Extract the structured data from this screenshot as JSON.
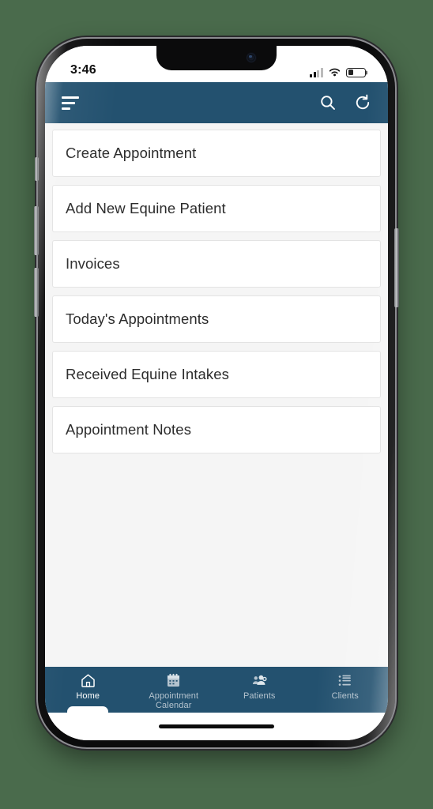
{
  "status_bar": {
    "time": "3:46",
    "signal_icon": "cellular-signal-icon",
    "signal_bars_filled": 2,
    "signal_bars_total": 4,
    "wifi_icon": "wifi-icon",
    "battery_icon": "battery-icon",
    "battery_percent": 32
  },
  "app_bar": {
    "menu_icon": "hamburger-menu-icon",
    "search_icon": "search-icon",
    "refresh_icon": "refresh-icon",
    "background_color": "#23516f"
  },
  "main": {
    "background_color": "#f5f5f5",
    "menu_items": [
      {
        "label": "Create Appointment"
      },
      {
        "label": "Add New Equine Patient"
      },
      {
        "label": "Invoices"
      },
      {
        "label": "Today's Appointments"
      },
      {
        "label": "Received Equine Intakes"
      },
      {
        "label": "Appointment Notes"
      }
    ]
  },
  "bottom_nav": {
    "background_color": "#23516f",
    "active_index": 0,
    "items": [
      {
        "label": "Home",
        "icon": "home-icon",
        "active": true
      },
      {
        "label": "Appointment\nCalendar",
        "label_line1": "Appointment",
        "label_line2": "Calendar",
        "icon": "calendar-icon",
        "active": false
      },
      {
        "label": "Patients",
        "icon": "people-group-icon",
        "active": false
      },
      {
        "label": "Clients",
        "icon": "list-icon",
        "active": false
      }
    ]
  },
  "device": {
    "frame_color": "#0b0b0c",
    "page_background": "#4a6b4c"
  }
}
